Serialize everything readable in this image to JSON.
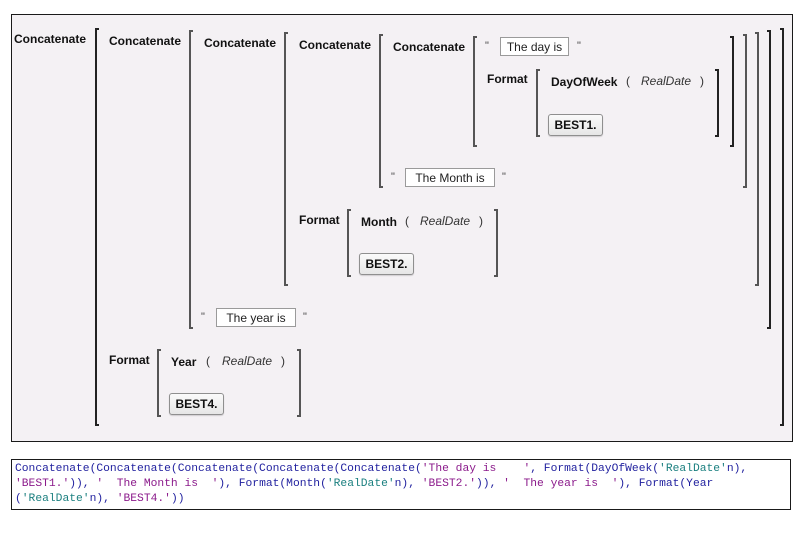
{
  "expression_tree": {
    "level1": {
      "function": "Concatenate"
    },
    "level2": {
      "function": "Concatenate"
    },
    "level3": {
      "function": "Concatenate"
    },
    "level4": {
      "function": "Concatenate"
    },
    "level5": {
      "function": "Concatenate",
      "string_literal": "The day is",
      "format": {
        "label": "Format",
        "function": "DayOfWeek",
        "open_paren": "(",
        "argument": "RealDate",
        "close_paren": ")",
        "format_button": "BEST1."
      }
    },
    "level4_string": "The Month is",
    "level3_format": {
      "label": "Format",
      "function": "Month",
      "open_paren": "(",
      "argument": "RealDate",
      "close_paren": ")",
      "format_button": "BEST2."
    },
    "level2_string": "The year is",
    "level1_format": {
      "label": "Format",
      "function": "Year",
      "open_paren": "(",
      "argument": "RealDate",
      "close_paren": ")",
      "format_button": "BEST4."
    },
    "quote_char": "\""
  },
  "code_view": {
    "lines": [
      "Concatenate(Concatenate(Concatenate(Concatenate(Concatenate('The day is    ', Format(DayOfWeek('RealDate'n),",
      "'BEST1.')), '  The Month is  '), Format(Month('RealDate'n), 'BEST2.')), '  The year is  '), Format(Year",
      "('RealDate'n), 'BEST4.'))"
    ]
  },
  "colors": {
    "panel_background": "#f4f1f4",
    "code_function": "#1f1f9e",
    "code_string": "#8b1a8b",
    "code_name_literal": "#1a7f7f"
  }
}
